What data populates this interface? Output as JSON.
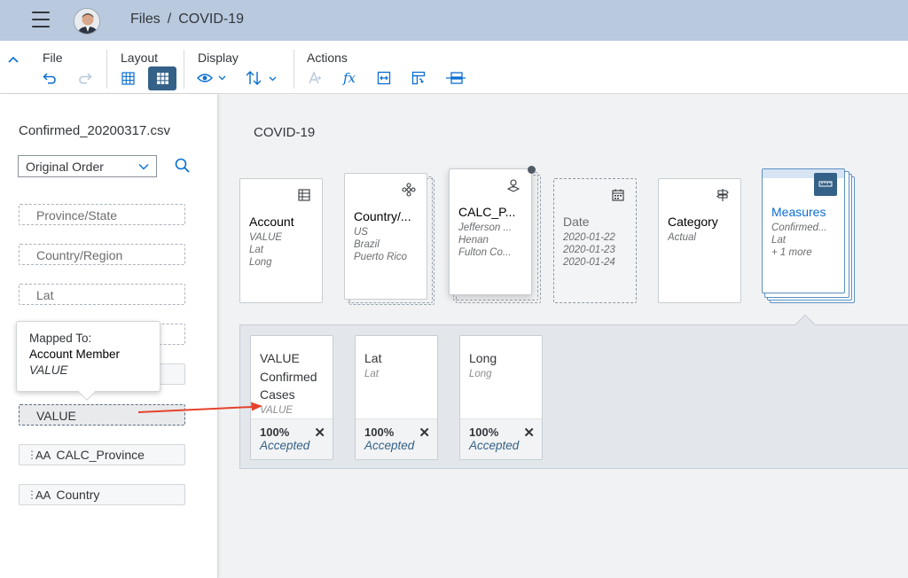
{
  "shell": {
    "breadcrumb_files": "Files",
    "breadcrumb_sep": "/",
    "breadcrumb_current": "COVID-19"
  },
  "toolbar": {
    "file_label": "File",
    "layout_label": "Layout",
    "display_label": "Display",
    "actions_label": "Actions",
    "fx_label": "fx"
  },
  "left": {
    "filename": "Confirmed_20200317.csv",
    "sort_selected": "Original Order",
    "fields": [
      {
        "label": "Province/State"
      },
      {
        "label": "Country/Region"
      },
      {
        "label": "Lat"
      },
      {
        "label": "VALUE"
      },
      {
        "label": "CALC_Province"
      },
      {
        "label": "Country"
      }
    ]
  },
  "popover": {
    "line1": "Mapped To:",
    "line2": "Account Member",
    "line3": "VALUE"
  },
  "canvas": {
    "title": "COVID-19",
    "cards": [
      {
        "title": "Account",
        "subs": [
          "VALUE",
          "Lat",
          "Long"
        ]
      },
      {
        "title": "Country/...",
        "subs": [
          "US",
          "Brazil",
          "Puerto Rico"
        ]
      },
      {
        "title": "CALC_P...",
        "subs": [
          "Jefferson ...",
          "Henan",
          "Fulton Co..."
        ]
      },
      {
        "title": "Date",
        "subs": [
          "2020-01-22",
          "2020-01-23",
          "2020-01-24"
        ]
      },
      {
        "title": "Category",
        "subs": [
          "Actual"
        ]
      },
      {
        "title": "Measures",
        "subs": [
          "Confirmed...",
          "Lat",
          "+ 1 more"
        ]
      }
    ]
  },
  "members": [
    {
      "title": "VALUE Confirmed Cases",
      "sub": "VALUE",
      "pct": "100%",
      "status": "Accepted"
    },
    {
      "title": "Lat",
      "sub": "Lat",
      "pct": "100%",
      "status": "Accepted"
    },
    {
      "title": "Long",
      "sub": "Long",
      "pct": "100%",
      "status": "Accepted"
    }
  ],
  "colors": {
    "shell": "#b9c9de",
    "accent": "#0a6ed1",
    "active_button": "#346187",
    "arrow": "#e5432c"
  }
}
